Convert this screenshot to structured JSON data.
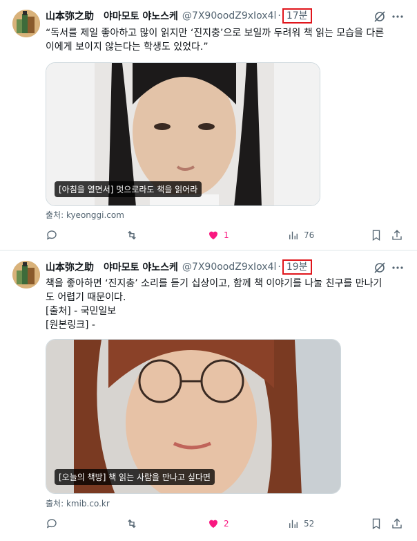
{
  "tweets": [
    {
      "author": "山本弥之助　야마모토 야노스케",
      "handle": "@7X90oodZ9xIox4l",
      "separator": "·",
      "time": "17분",
      "lines": [
        "“독서를 제일 좋아하고 많이 읽지만 ‘진지충’으로 보일까 두려워 책 읽는 모습을 다른",
        "이에게 보이지 않는다는 학생도 있었다.”"
      ],
      "card_label": "[아침을 열면서] 멋으로라도 책을 읽어라",
      "source": "출처: kyeonggi.com",
      "replies": "",
      "retweets": "",
      "likes": "1",
      "views": "76"
    },
    {
      "author": "山本弥之助　야마모토 야노스케",
      "handle": "@7X90oodZ9xIox4l",
      "separator": "·",
      "time": "19분",
      "lines": [
        "책을 좋아하면 ‘진지충’ 소리를 듣기 십상이고, 함께 책 이야기를 나눌 친구를 만나기",
        "도 어렵기 때문이다.",
        "[출처] - 국민일보",
        "[원본링크] -"
      ],
      "card_label": "[오늘의 책방] 책 읽는 사람을 만나고 싶다면",
      "source": "출처: kmib.co.kr",
      "replies": "",
      "retweets": "",
      "likes": "2",
      "views": "52"
    }
  ],
  "colors": {
    "accent_highlight": "#e0151b",
    "like_pink": "#f91880",
    "secondary_text": "#536471"
  }
}
